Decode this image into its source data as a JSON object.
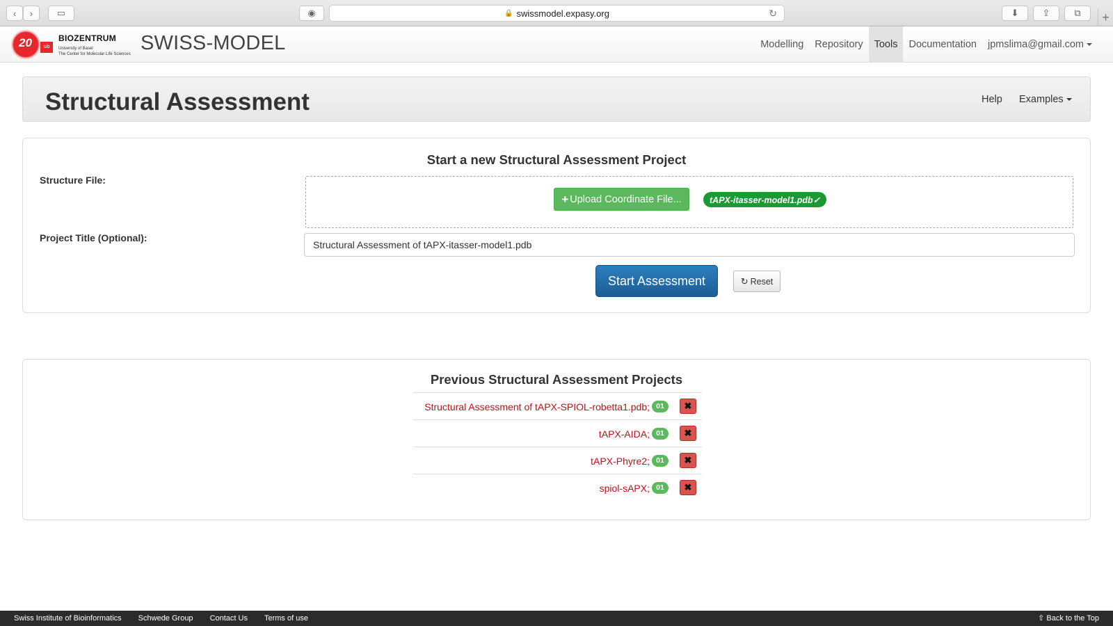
{
  "browser": {
    "url": "swissmodel.expasy.org"
  },
  "header": {
    "logo_number": "20",
    "logo_sib": "sib",
    "biozentrum_name": "BIOZENTRUM",
    "biozentrum_sub1": "University of Basel",
    "biozentrum_sub2": "The Center for Molecular Life Sciences",
    "brand": "SWISS-MODEL",
    "nav": [
      {
        "label": "Modelling",
        "active": false
      },
      {
        "label": "Repository",
        "active": false
      },
      {
        "label": "Tools",
        "active": true
      },
      {
        "label": "Documentation",
        "active": false
      },
      {
        "label": "jpmslima@gmail.com",
        "active": false
      }
    ]
  },
  "page": {
    "title": "Structural Assessment",
    "help": "Help",
    "examples": "Examples"
  },
  "new_project": {
    "heading": "Start a new Structural Assessment Project",
    "structure_label": "Structure File:",
    "upload_label": "Upload Coordinate File...",
    "file_name": "tAPX-itasser-model1.pdb✓",
    "title_label": "Project Title (Optional):",
    "title_value": "Structural Assessment of tAPX-itasser-model1.pdb",
    "start_label": "Start Assessment",
    "reset_label": "Reset"
  },
  "previous": {
    "heading": "Previous Structural Assessment Projects",
    "projects": [
      {
        "name": "Structural Assessment of tAPX-SPIOL-robetta1.pdb;",
        "count": "01"
      },
      {
        "name": "tAPX-AIDA;",
        "count": "01"
      },
      {
        "name": "tAPX-Phyre2;",
        "count": "01"
      },
      {
        "name": "spiol-sAPX;",
        "count": "01"
      }
    ]
  },
  "footer": {
    "links": [
      "Swiss Institute of Bioinformatics",
      "Schwede Group",
      "Contact Us",
      "Terms of use"
    ],
    "back_to_top": "Back to the Top"
  },
  "colors": {
    "upload_green": "#5cb85c",
    "start_blue": "#1b5e94",
    "link_red": "#c0111a",
    "delete_red": "#d9534f"
  }
}
